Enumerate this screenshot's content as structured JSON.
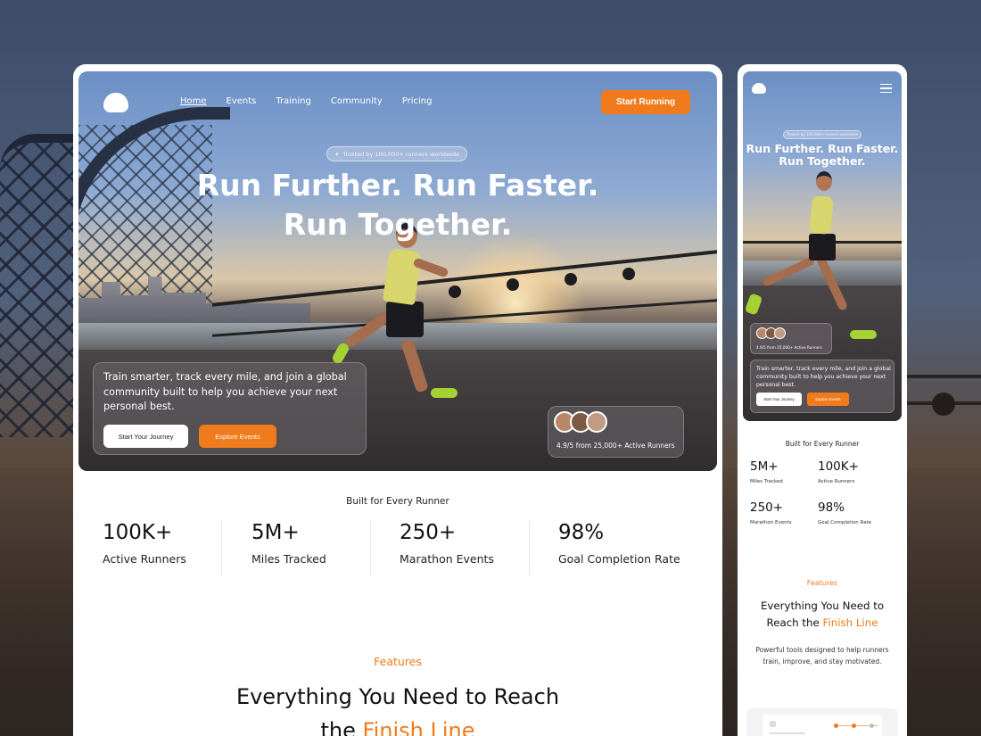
{
  "desktop": {
    "nav": {
      "links": [
        "Home",
        "Events",
        "Training",
        "Community",
        "Pricing"
      ],
      "cta": "Start Running"
    },
    "hero": {
      "trust_badge": "Trusted by 100,000+ runners worldwide",
      "headline_line1": "Run Further. Run Faster.",
      "headline_line2": "Run Together.",
      "description": "Train smarter, track every mile, and join a global community built to help you achieve your next personal best.",
      "primary_button": "Start Your Journey",
      "secondary_button": "Explore Events",
      "rating": "4.9/5 from 25,000+ Active Runners"
    },
    "stats": {
      "title": "Built for Every Runner",
      "items": [
        {
          "value": "100K+",
          "label": "Active Runners"
        },
        {
          "value": "5M+",
          "label": "Miles Tracked"
        },
        {
          "value": "250+",
          "label": "Marathon Events"
        },
        {
          "value": "98%",
          "label": "Goal Completion Rate"
        }
      ]
    },
    "features": {
      "tag": "Features",
      "title_part1": "Everything You Need to Reach",
      "title_part2": "the",
      "title_highlight": "Finish Line"
    }
  },
  "mobile": {
    "hero": {
      "trust_badge": "Trusted by 100,000+ runners worldwide",
      "headline_line1": "Run Further. Run Faster.",
      "headline_line2": "Run Together.",
      "rating": "4.9/5 from 25,000+ Active Runners",
      "description": "Train smarter, track every mile, and join a global community built to help you achieve your next personal best.",
      "primary_button": "Start Your Journey",
      "secondary_button": "Explore Events"
    },
    "stats": {
      "title": "Built for Every Runner",
      "items": [
        {
          "value": "5M+",
          "label": "Miles Tracked"
        },
        {
          "value": "100K+",
          "label": "Active Runners"
        },
        {
          "value": "250+",
          "label": "Marathon Events"
        },
        {
          "value": "98%",
          "label": "Goal Completion Rate"
        }
      ]
    },
    "features": {
      "tag": "Features",
      "title_line1": "Everything You Need to",
      "title_part2": "Reach the",
      "title_highlight": "Finish Line",
      "description": "Powerful tools designed to help runners train, improve, and stay motivated."
    }
  },
  "colors": {
    "accent": "#f07b1c",
    "text": "#111111",
    "card_bg": "#ffffff"
  },
  "icons": [
    "cloud-logo-icon",
    "menu-icon",
    "sparkle-icon"
  ]
}
